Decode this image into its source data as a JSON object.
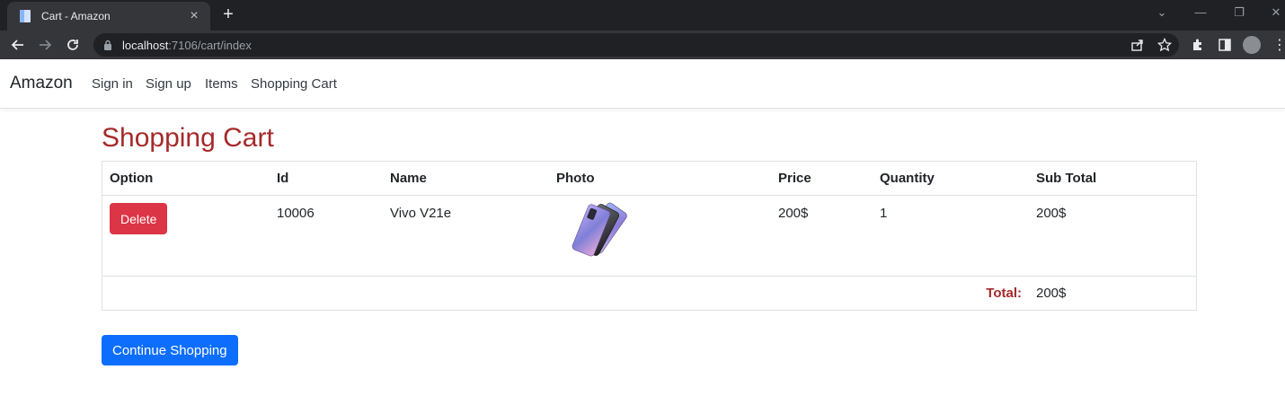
{
  "browser": {
    "tab_title": "Cart - Amazon",
    "tab_close": "×",
    "new_tab": "+",
    "url_host": "localhost",
    "url_path": ":7106/cart/index"
  },
  "nav": {
    "brand": "Amazon",
    "links": [
      "Sign in",
      "Sign up",
      "Items",
      "Shopping Cart"
    ]
  },
  "page": {
    "title": "Shopping Cart"
  },
  "table": {
    "headers": [
      "Option",
      "Id",
      "Name",
      "Photo",
      "Price",
      "Quantity",
      "Sub Total"
    ],
    "rows": [
      {
        "option_label": "Delete",
        "id": "10006",
        "name": "Vivo V21e",
        "photo": "vivo-v21e-phone-image",
        "price": "200$",
        "quantity": "1",
        "sub_total": "200$"
      }
    ],
    "total_label": "Total:",
    "total_value": "200$"
  },
  "actions": {
    "continue_label": "Continue Shopping"
  },
  "colors": {
    "title": "#a52a2a",
    "delete_button": "#dc3545",
    "primary_button": "#0d6efd"
  }
}
